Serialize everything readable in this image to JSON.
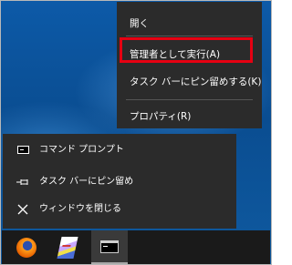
{
  "context_menu": {
    "items": [
      {
        "label": "開く"
      },
      {
        "label": "管理者として実行(A)"
      },
      {
        "label": "タスク バーにピン留めする(K)"
      },
      {
        "label": "プロパティ(R)"
      }
    ],
    "highlight_color": "#e60012"
  },
  "jump_list": {
    "items": [
      {
        "label": "コマンド プロンプト",
        "icon": "command-prompt-icon"
      },
      {
        "label": "タスク バーにピン留め",
        "icon": "pin-icon"
      },
      {
        "label": "ウィンドウを閉じる",
        "icon": "close-icon"
      }
    ]
  },
  "taskbar": {
    "apps": [
      {
        "icon": "firefox-icon"
      },
      {
        "icon": "text-editor-icon"
      },
      {
        "icon": "command-prompt-icon",
        "active": true
      }
    ]
  },
  "colors": {
    "desktop": "#0a4d91",
    "menu_bg": "#2b2b2b",
    "taskbar_bg": "#1a1a1a"
  }
}
